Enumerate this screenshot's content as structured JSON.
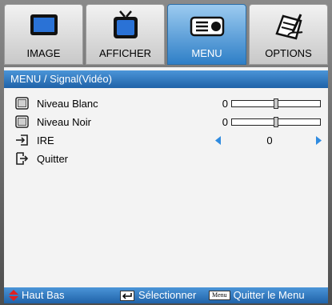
{
  "tabs": [
    {
      "label": "IMAGE",
      "icon": "monitor-icon",
      "active": false
    },
    {
      "label": "AFFICHER",
      "icon": "tv-icon",
      "active": false
    },
    {
      "label": "MENU",
      "icon": "projector-icon",
      "active": true
    },
    {
      "label": "OPTIONS",
      "icon": "options-icon",
      "active": false
    }
  ],
  "panel": {
    "title": "MENU / Signal(Vidéo)",
    "rows": [
      {
        "label": "Niveau Blanc",
        "value": "0",
        "control": "slider",
        "level": 0.5
      },
      {
        "label": "Niveau Noir",
        "value": "0",
        "control": "slider",
        "level": 0.5
      },
      {
        "label": "IRE",
        "value": "0",
        "control": "selector"
      },
      {
        "label": "Quitter",
        "control": "none"
      }
    ]
  },
  "footer": {
    "nav_label": "Haut Bas",
    "select_label": "Sélectionner",
    "menu_key": "Menu",
    "exit_label": "Quitter le Menu"
  },
  "colors": {
    "accent_blue": "#1f62a8",
    "arrow_blue": "#2f8be0",
    "nav_red": "#e02020"
  }
}
